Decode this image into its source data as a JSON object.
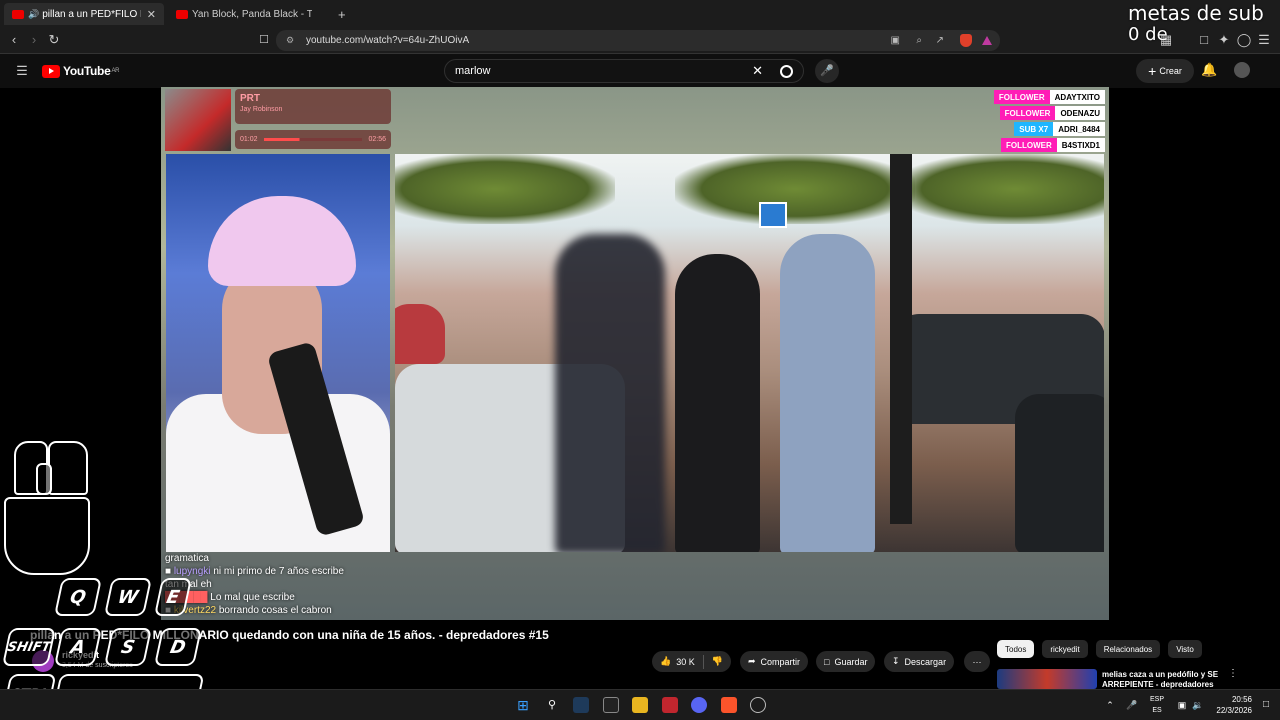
{
  "browser": {
    "tabs": [
      {
        "label": "pillan a un PED*FILO MILLONA",
        "active": true
      },
      {
        "label": "Yan Block, Panda Black - Talento (Vid",
        "active": false
      }
    ],
    "new_tab": "+",
    "url": "youtube.com/watch?v=64u-ZhUOivA"
  },
  "youtube": {
    "logo": "YouTube",
    "region": "AR",
    "search_value": "marlow",
    "create_label": "Crear"
  },
  "stream": {
    "music": {
      "title": "PRT",
      "artist": "Jay Robinson",
      "elapsed": "01:02",
      "total": "02:56",
      "progress": 0.36
    },
    "alerts": [
      {
        "kind": "FOLLOWER",
        "name": "ADAYTXITO"
      },
      {
        "kind": "FOLLOWER",
        "name": "ODENAZU"
      },
      {
        "kind": "SUB X7",
        "name": "ADRI_8484"
      },
      {
        "kind": "FOLLOWER",
        "name": "B4STIXD1"
      }
    ],
    "chat": [
      {
        "user": "",
        "text": "gramatica"
      },
      {
        "user": "lupyngki",
        "text": "ni mi primo de 7 años escribe"
      },
      {
        "user": "",
        "text": "tan mal eh"
      },
      {
        "user": "",
        "text": "Lo mal que escribe"
      },
      {
        "user": "kilvertz22",
        "text": "borrando cosas el cabron"
      }
    ],
    "goal_line1": "metas de sub",
    "goal_line2": "0 de"
  },
  "video": {
    "title": "pillan a un PED*FILO MILLONARIO quedando con una niña de 15 años. - depredadores #15",
    "channel": "rickyedit",
    "subscribers": "3,54 M de suscriptores",
    "likes": "30 K",
    "share": "Compartir",
    "save": "Guardar",
    "download": "Descargar",
    "more": "···"
  },
  "sidebar": {
    "chips": [
      "Todos",
      "rickyedit",
      "Relacionados",
      "Visto"
    ],
    "related_title": "melias caza a un pedófilo y SE ARREPIENTE - depredadores"
  },
  "keyboard": {
    "keys": [
      "Q",
      "W",
      "E",
      "A",
      "S",
      "D",
      "SHIFT",
      "CTRL"
    ]
  },
  "taskbar": {
    "lang_top": "ESP",
    "lang_bottom": "ES",
    "time": "20:56",
    "date": "22/3/2026"
  }
}
